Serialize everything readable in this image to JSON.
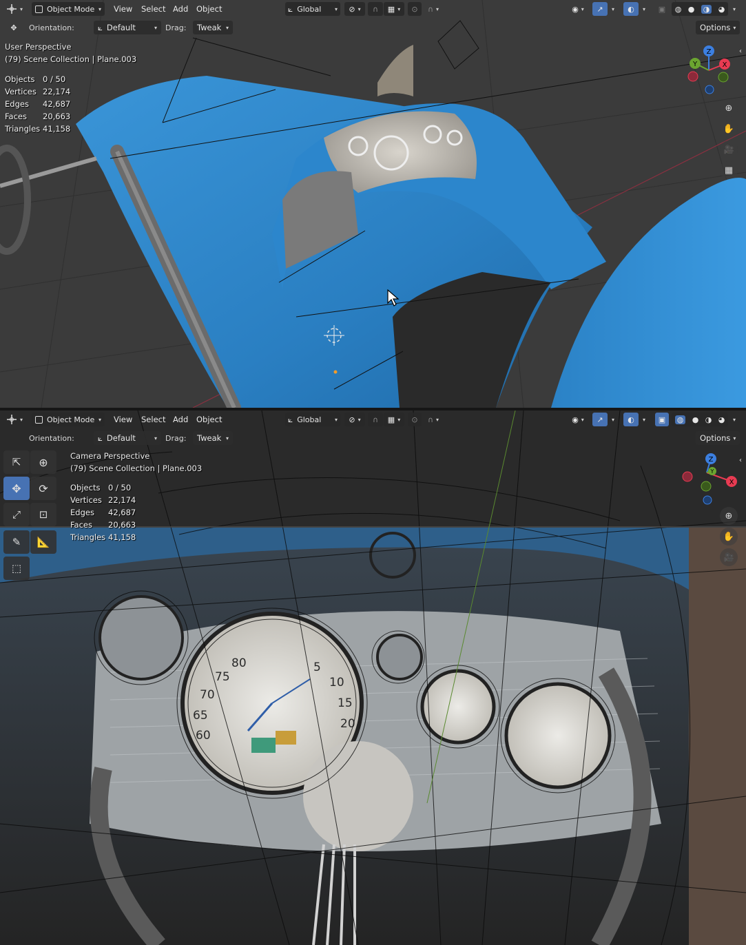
{
  "top_viewport": {
    "header": {
      "editor_type_icon": "move-gizmo-icon",
      "mode": "Object Mode",
      "menus": [
        "View",
        "Select",
        "Add",
        "Object"
      ],
      "transform_orientation": "Global"
    },
    "tool_header": {
      "orientation_label": "Orientation:",
      "orientation_value": "Default",
      "drag_label": "Drag:",
      "drag_value": "Tweak",
      "options_label": "Options"
    },
    "overlay": {
      "view_name": "User Perspective",
      "collection": "(79) Scene Collection | Plane.003"
    },
    "stats": [
      {
        "label": "Objects",
        "value": "0 / 50"
      },
      {
        "label": "Vertices",
        "value": "22,174"
      },
      {
        "label": "Edges",
        "value": "42,687"
      },
      {
        "label": "Faces",
        "value": "20,663"
      },
      {
        "label": "Triangles",
        "value": "41,158"
      }
    ],
    "gizmo": {
      "x_label": "X",
      "y_label": "Y",
      "z_label": "Z"
    }
  },
  "bottom_viewport": {
    "header": {
      "mode": "Object Mode",
      "menus": [
        "View",
        "Select",
        "Add",
        "Object"
      ],
      "transform_orientation": "Global"
    },
    "tool_header": {
      "orientation_label": "Orientation:",
      "orientation_value": "Default",
      "drag_label": "Drag:",
      "drag_value": "Tweak",
      "options_label": "Options"
    },
    "overlay": {
      "view_name": "Camera Perspective",
      "collection": "(79) Scene Collection | Plane.003"
    },
    "stats": [
      {
        "label": "Objects",
        "value": "0 / 50"
      },
      {
        "label": "Vertices",
        "value": "22,174"
      },
      {
        "label": "Edges",
        "value": "42,687"
      },
      {
        "label": "Faces",
        "value": "20,663"
      },
      {
        "label": "Triangles",
        "value": "41,158"
      }
    ],
    "gizmo": {
      "x_label": "X",
      "y_label": "Y",
      "z_label": "Z"
    },
    "gauge_numbers": [
      "75",
      "80",
      "70",
      "65",
      "60",
      "5",
      "10",
      "15",
      "20"
    ]
  },
  "colors": {
    "accent": "#4772b3",
    "car_body": "#2f86cc",
    "axis_x": "#e83b52",
    "axis_y": "#6ba530",
    "axis_z": "#3c7fe0"
  }
}
